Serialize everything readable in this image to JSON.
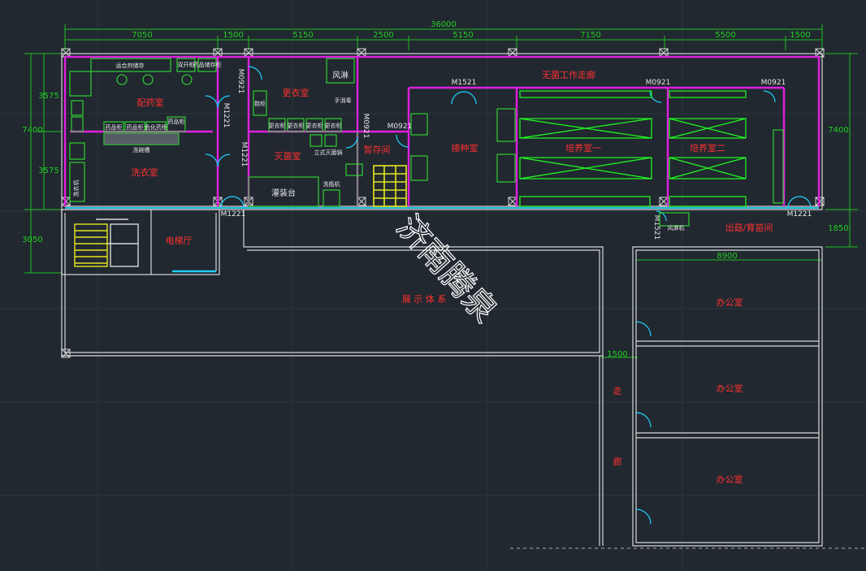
{
  "dimensions": {
    "overall": "36000",
    "top": [
      "7050",
      "1500",
      "5150",
      "2500",
      "5150",
      "7150",
      "5500",
      "1500"
    ],
    "left": [
      "3575",
      "7400",
      "3575",
      "3050"
    ],
    "right": [
      "7400",
      "1850"
    ],
    "width_8900": "8900",
    "width_1500": "1500"
  },
  "rooms": {
    "peiyao": "配药室",
    "xiyi": "洗衣室",
    "gengyi": "更衣室",
    "mianjun": "灭菌室",
    "zanfang": "暂存间",
    "jieliao": "接种室",
    "peiyang1": "培养室一",
    "peiyang2": "培养室二",
    "wujun_corridor": "无菌工作走廊",
    "dianti": "电梯厅",
    "zhanshi": "展 示 体 系",
    "chuchuang": "出菇/育苗间",
    "office1": "办公室",
    "office2": "办公室",
    "office3": "办公室",
    "zou": "走",
    "lang": "廊",
    "fenglin": "风淋"
  },
  "door_labels": {
    "m1221_a": "M1221",
    "m1221_b": "M1221",
    "m1221_c": "M1221",
    "m1221_d": "M1221",
    "m0921_a": "M0921",
    "m0921_b": "M0921",
    "m0921_c": "M0921",
    "m0921_d": "M0921",
    "m0921_e": "M0921",
    "m1521_a": "M1521",
    "m1521_b": "M1521"
  },
  "equipment": {
    "yunfen": "运合剂储存",
    "shuangren": "双开柜",
    "yanglai": "药品储存柜",
    "yaopin1": "药品柜",
    "yaopin2": "药品柜",
    "yaopin3": "危化药柜",
    "yaopin4": "药品柜",
    "xiwanqi": "洗碗槽",
    "xiyiji": "洗衣机",
    "gengyigui1": "更衣柜",
    "gengyigui2": "更衣柜",
    "gengyigui3": "更衣柜",
    "gengyigui4": "更衣柜",
    "gengxie": "鞋柜",
    "shoushi": "手消毒",
    "lishi": "立式灭菌锅",
    "guanzhuang": "灌装台",
    "xiping": "洗瓶机",
    "fenglinji": "风淋机"
  },
  "watermark": "济南腾泉"
}
